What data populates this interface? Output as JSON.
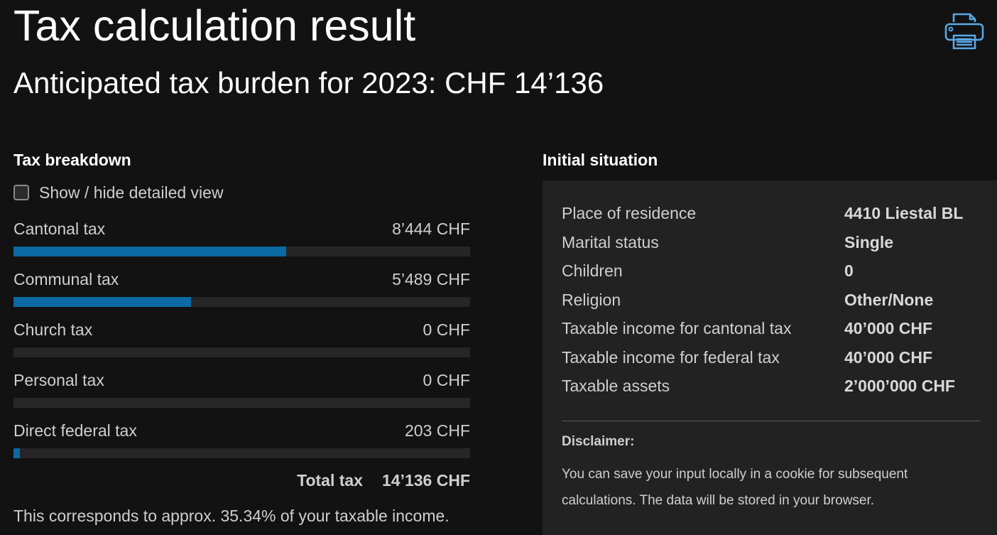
{
  "header": {
    "title": "Tax calculation result",
    "subtitle": "Anticipated tax burden for 2023: CHF 14’136",
    "print_icon": "printer-icon"
  },
  "breakdown": {
    "heading": "Tax breakdown",
    "toggle_label": "Show / hide detailed view",
    "toggle_checked": false,
    "items": [
      {
        "label": "Cantonal tax",
        "value": "8’444 CHF",
        "share": 0.5973
      },
      {
        "label": "Communal tax",
        "value": "5’489 CHF",
        "share": 0.3883
      },
      {
        "label": "Church tax",
        "value": "0 CHF",
        "share": 0
      },
      {
        "label": "Personal tax",
        "value": "0 CHF",
        "share": 0
      },
      {
        "label": "Direct federal tax",
        "value": "203 CHF",
        "share": 0.0144
      }
    ],
    "total_label": "Total tax",
    "total_value": "14’136 CHF",
    "footnote": "This corresponds to approx. 35.34% of your taxable income."
  },
  "situation": {
    "heading": "Initial situation",
    "rows": [
      {
        "label": "Place of residence",
        "value": "4410 Liestal BL"
      },
      {
        "label": "Marital status",
        "value": "Single"
      },
      {
        "label": "Children",
        "value": "0"
      },
      {
        "label": "Religion",
        "value": "Other/None"
      },
      {
        "label": "Taxable income for cantonal tax",
        "value": "40’000 CHF"
      },
      {
        "label": "Taxable income for federal tax",
        "value": "40’000 CHF"
      },
      {
        "label": "Taxable assets",
        "value": "2’000’000 CHF"
      }
    ],
    "disclaimer_title": "Disclaimer:",
    "disclaimer_text": "You can save your input locally in a cookie for subsequent calculations. The data will be stored in your browser."
  },
  "colors": {
    "background": "#121212",
    "panel": "#222222",
    "bar_fill": "#0b6aa2",
    "bar_track": "#262626",
    "icon_accent": "#5aa8e6"
  }
}
